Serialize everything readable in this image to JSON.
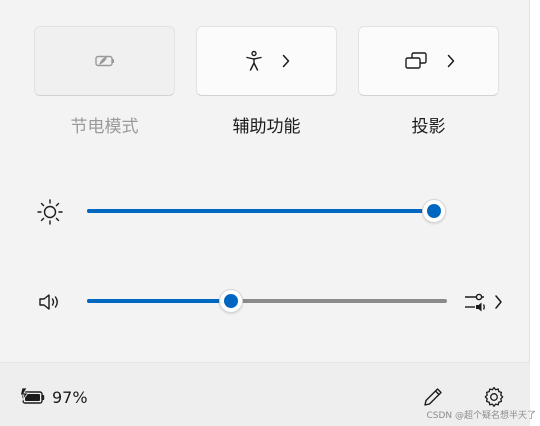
{
  "accent_color": "#0067c0",
  "tiles": [
    {
      "label": "节电模式",
      "icon": "battery-saver-icon",
      "enabled": false,
      "has_chevron": false
    },
    {
      "label": "辅助功能",
      "icon": "accessibility-icon",
      "enabled": true,
      "has_chevron": true
    },
    {
      "label": "投影",
      "icon": "project-display-icon",
      "enabled": true,
      "has_chevron": true
    }
  ],
  "brightness": {
    "icon": "sun-icon",
    "level_percent": 100
  },
  "volume": {
    "icon": "speaker-icon",
    "level_percent": 40,
    "output_icon": "audio-output-select-icon"
  },
  "footer": {
    "battery_icon": "battery-charging-icon",
    "battery_percent": "97%",
    "edit_icon": "pencil-icon",
    "settings_icon": "gear-icon"
  },
  "watermark": "CSDN @超个疑名想半天了"
}
